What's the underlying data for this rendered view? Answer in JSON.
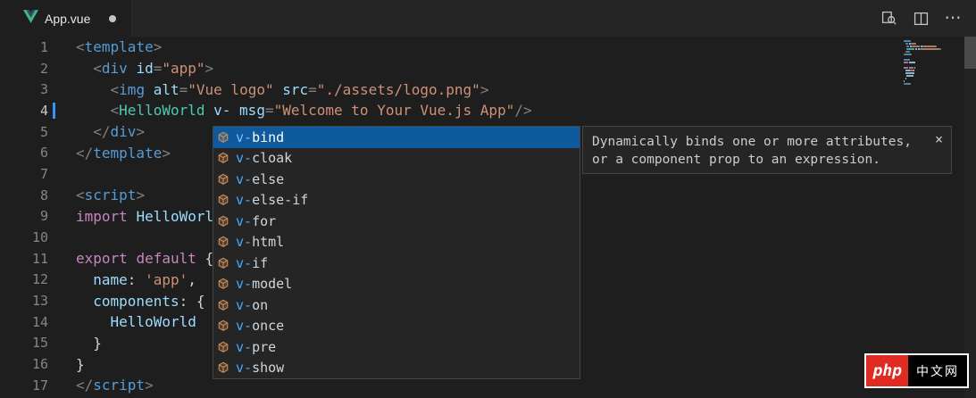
{
  "colors": {
    "tokens": {
      "tag": "#569cd6",
      "punct": "#808080",
      "attr": "#9cdcfe",
      "str": "#ce9178",
      "kw": "#c586c0",
      "comp": "#4ec9b0",
      "plain": "#d4d4d4",
      "ws": "transparent"
    },
    "selected_suggestion_bg": "#0e5a9c",
    "match_highlight": "#4aa9fc",
    "vue_green": "#41b883",
    "vue_dark": "#34495e",
    "watermark_red": "#e02b20"
  },
  "tab_bar": {
    "tab": {
      "title": "App.vue",
      "modified": true
    },
    "actions": [
      {
        "name": "open-preview",
        "icon": "preview-icon"
      },
      {
        "name": "split-editor",
        "icon": "split-editor-icon"
      },
      {
        "name": "more-actions",
        "icon": "ellipsis-icon",
        "glyph": "⋯"
      }
    ]
  },
  "editor": {
    "current_line": 4,
    "lines": [
      {
        "num": "1",
        "segments": [
          {
            "t": "<",
            "k": "punct"
          },
          {
            "t": "template",
            "k": "tag"
          },
          {
            "t": ">",
            "k": "punct"
          }
        ]
      },
      {
        "num": "2",
        "segments": [
          {
            "t": "  ",
            "k": "ws"
          },
          {
            "t": "<",
            "k": "punct"
          },
          {
            "t": "div",
            "k": "tag"
          },
          {
            "t": " ",
            "k": "ws"
          },
          {
            "t": "id",
            "k": "attr"
          },
          {
            "t": "=",
            "k": "punct"
          },
          {
            "t": "\"app\"",
            "k": "str"
          },
          {
            "t": ">",
            "k": "punct"
          }
        ]
      },
      {
        "num": "3",
        "segments": [
          {
            "t": "    ",
            "k": "ws"
          },
          {
            "t": "<",
            "k": "punct"
          },
          {
            "t": "img",
            "k": "tag"
          },
          {
            "t": " ",
            "k": "ws"
          },
          {
            "t": "alt",
            "k": "attr"
          },
          {
            "t": "=",
            "k": "punct"
          },
          {
            "t": "\"Vue logo\"",
            "k": "str"
          },
          {
            "t": " ",
            "k": "ws"
          },
          {
            "t": "src",
            "k": "attr"
          },
          {
            "t": "=",
            "k": "punct"
          },
          {
            "t": "\"./assets/logo.png\"",
            "k": "str"
          },
          {
            "t": ">",
            "k": "punct"
          }
        ]
      },
      {
        "num": "4",
        "segments": [
          {
            "t": "    ",
            "k": "ws"
          },
          {
            "t": "<",
            "k": "punct"
          },
          {
            "t": "HelloWorld",
            "k": "comp"
          },
          {
            "t": " ",
            "k": "ws"
          },
          {
            "t": "v-",
            "k": "attr"
          },
          {
            "t": " ",
            "k": "ws"
          },
          {
            "t": "msg",
            "k": "attr"
          },
          {
            "t": "=",
            "k": "punct"
          },
          {
            "t": "\"Welcome to Your Vue.js App\"",
            "k": "str"
          },
          {
            "t": "/>",
            "k": "punct"
          }
        ]
      },
      {
        "num": "5",
        "segments": [
          {
            "t": "  ",
            "k": "ws"
          },
          {
            "t": "</",
            "k": "punct"
          },
          {
            "t": "div",
            "k": "tag"
          },
          {
            "t": ">",
            "k": "punct"
          }
        ]
      },
      {
        "num": "6",
        "segments": [
          {
            "t": "</",
            "k": "punct"
          },
          {
            "t": "template",
            "k": "tag"
          },
          {
            "t": ">",
            "k": "punct"
          }
        ]
      },
      {
        "num": "7",
        "segments": []
      },
      {
        "num": "8",
        "segments": [
          {
            "t": "<",
            "k": "punct"
          },
          {
            "t": "script",
            "k": "tag"
          },
          {
            "t": ">",
            "k": "punct"
          }
        ]
      },
      {
        "num": "9",
        "segments": [
          {
            "t": "import",
            "k": "kw"
          },
          {
            "t": " ",
            "k": "ws"
          },
          {
            "t": "HelloWorl",
            "k": "attr"
          }
        ]
      },
      {
        "num": "10",
        "segments": []
      },
      {
        "num": "11",
        "segments": [
          {
            "t": "export",
            "k": "kw"
          },
          {
            "t": " ",
            "k": "ws"
          },
          {
            "t": "default",
            "k": "kw"
          },
          {
            "t": " ",
            "k": "ws"
          },
          {
            "t": "{",
            "k": "plain"
          }
        ]
      },
      {
        "num": "12",
        "segments": [
          {
            "t": "  ",
            "k": "ws"
          },
          {
            "t": "name",
            "k": "attr"
          },
          {
            "t": ": ",
            "k": "plain"
          },
          {
            "t": "'app'",
            "k": "str"
          },
          {
            "t": ",",
            "k": "plain"
          }
        ]
      },
      {
        "num": "13",
        "segments": [
          {
            "t": "  ",
            "k": "ws"
          },
          {
            "t": "components",
            "k": "attr"
          },
          {
            "t": ": {",
            "k": "plain"
          }
        ]
      },
      {
        "num": "14",
        "segments": [
          {
            "t": "    ",
            "k": "ws"
          },
          {
            "t": "HelloWorld",
            "k": "attr"
          }
        ]
      },
      {
        "num": "15",
        "segments": [
          {
            "t": "  ",
            "k": "ws"
          },
          {
            "t": "}",
            "k": "plain"
          }
        ]
      },
      {
        "num": "16",
        "segments": [
          {
            "t": "}",
            "k": "plain"
          }
        ]
      },
      {
        "num": "17",
        "segments": [
          {
            "t": "</",
            "k": "punct"
          },
          {
            "t": "script",
            "k": "tag"
          },
          {
            "t": ">",
            "k": "punct"
          }
        ]
      }
    ]
  },
  "suggest": {
    "typed_prefix": "v-",
    "items": [
      {
        "label": "v-bind",
        "match": "v-",
        "rest": "bind",
        "kind": "property",
        "selected": true
      },
      {
        "label": "v-cloak",
        "match": "v-",
        "rest": "cloak",
        "kind": "property",
        "selected": false
      },
      {
        "label": "v-else",
        "match": "v-",
        "rest": "else",
        "kind": "property",
        "selected": false
      },
      {
        "label": "v-else-if",
        "match": "v-",
        "rest": "else-if",
        "kind": "property",
        "selected": false
      },
      {
        "label": "v-for",
        "match": "v-",
        "rest": "for",
        "kind": "property",
        "selected": false
      },
      {
        "label": "v-html",
        "match": "v-",
        "rest": "html",
        "kind": "property",
        "selected": false
      },
      {
        "label": "v-if",
        "match": "v-",
        "rest": "if",
        "kind": "property",
        "selected": false
      },
      {
        "label": "v-model",
        "match": "v-",
        "rest": "model",
        "kind": "property",
        "selected": false
      },
      {
        "label": "v-on",
        "match": "v-",
        "rest": "on",
        "kind": "property",
        "selected": false
      },
      {
        "label": "v-once",
        "match": "v-",
        "rest": "once",
        "kind": "property",
        "selected": false
      },
      {
        "label": "v-pre",
        "match": "v-",
        "rest": "pre",
        "kind": "property",
        "selected": false
      },
      {
        "label": "v-show",
        "match": "v-",
        "rest": "show",
        "kind": "property",
        "selected": false
      }
    ]
  },
  "doc_popup": {
    "text": "Dynamically binds one or more attributes, or a component prop to an expression.",
    "close_label": "×"
  },
  "watermark": {
    "brand": "php",
    "suffix": "中文网"
  }
}
